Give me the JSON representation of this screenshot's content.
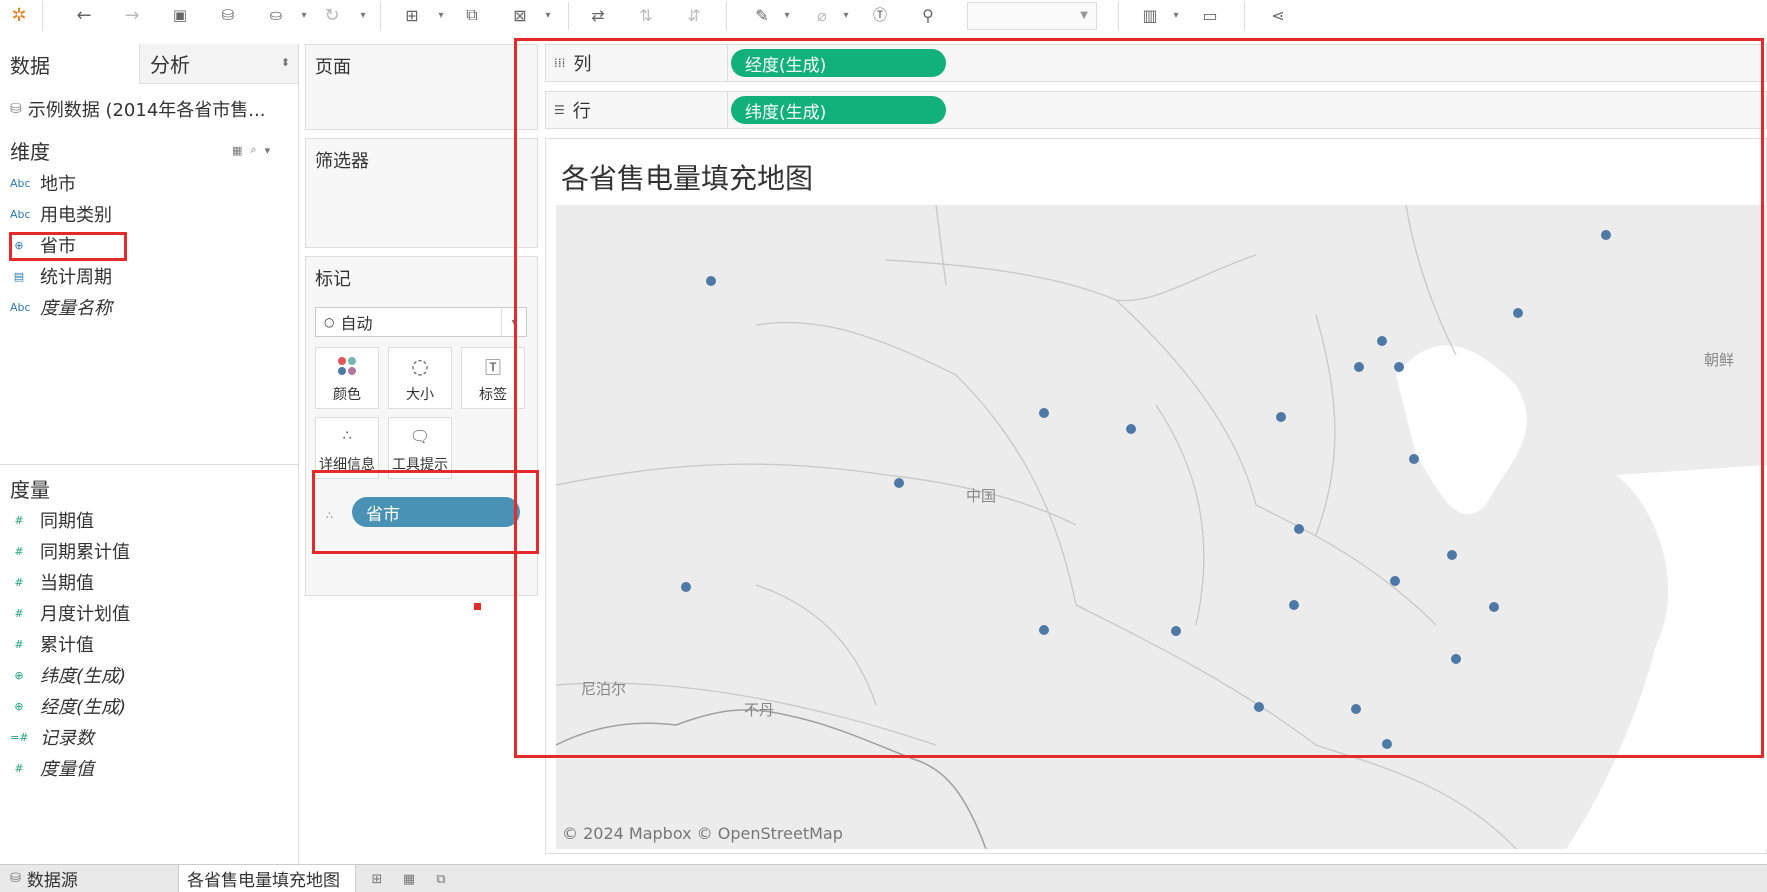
{
  "toolbar": {
    "icons": [
      "tableau-logo-icon",
      "undo-icon",
      "redo-icon",
      "save-icon",
      "new-datasource-icon",
      "pause-update-icon",
      "refresh-icon",
      "new-worksheet-icon",
      "duplicate-icon",
      "clear-sheet-icon",
      "swap-icon",
      "sort-asc-icon",
      "sort-desc-icon",
      "highlight-icon",
      "attach-icon",
      "label-icon",
      "pin-icon",
      "show-me-icon",
      "presentation-icon",
      "share-icon"
    ]
  },
  "left_pane": {
    "tab_data": "数据",
    "tab_analysis": "分析",
    "datasource": "示例数据 (2014年各省市售...",
    "dimensions_header": "维度",
    "dimensions": [
      {
        "label": "地市",
        "icon": "Abc"
      },
      {
        "label": "用电类别",
        "icon": "Abc"
      },
      {
        "label": "省市",
        "icon": "globe"
      },
      {
        "label": "统计周期",
        "icon": "calendar"
      },
      {
        "label": "度量名称",
        "icon": "Abc"
      }
    ],
    "measures_header": "度量",
    "measures": [
      {
        "label": "同期值",
        "icon": "#"
      },
      {
        "label": "同期累计值",
        "icon": "#"
      },
      {
        "label": "当期值",
        "icon": "#"
      },
      {
        "label": "月度计划值",
        "icon": "#"
      },
      {
        "label": "累计值",
        "icon": "#"
      },
      {
        "label": "纬度(生成)",
        "icon": "globe"
      },
      {
        "label": "经度(生成)",
        "icon": "globe"
      },
      {
        "label": "记录数",
        "icon": "#"
      },
      {
        "label": "度量值",
        "icon": "#"
      }
    ]
  },
  "cards": {
    "pages": "页面",
    "filters": "筛选器",
    "marks": "标记",
    "marks_type": "自动",
    "buttons": {
      "color": "颜色",
      "size": "大小",
      "label": "标签",
      "detail": "详细信息",
      "tooltip": "工具提示"
    },
    "detail_pill": "省市"
  },
  "shelves": {
    "columns_label": "列",
    "columns_pill": "经度(生成)",
    "rows_label": "行",
    "rows_pill": "纬度(生成)"
  },
  "viz": {
    "title": "各省售电量填充地图",
    "country_label": "中国",
    "nepal_label": "尼泊尔",
    "bhutan_label": "不丹",
    "korea_label": "朝鲜",
    "attribution": "© 2024 Mapbox © OpenStreetMap",
    "point_color": "#4e79a7"
  },
  "bottom_tabs": {
    "datasource": "数据源",
    "sheet": "各省售电量填充地图"
  }
}
